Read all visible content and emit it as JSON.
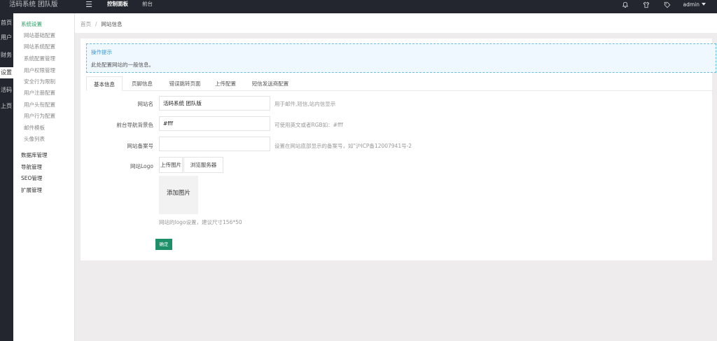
{
  "app": {
    "title": "活码系统 团队版"
  },
  "topnav": {
    "items": [
      "控制面板",
      "前台"
    ]
  },
  "topright": {
    "admin": "admin",
    "icons": [
      "bell-icon",
      "shirt-icon",
      "tag-icon"
    ]
  },
  "rail": {
    "items": [
      "首页",
      "用户",
      "财务",
      "设置",
      "活码",
      "上页"
    ]
  },
  "subnav": {
    "head": "系统设置",
    "children": [
      "网站基础配置",
      "网站系统配置",
      "系统配置管理",
      "用户权限管理",
      "安全行为限制",
      "用户注册配置",
      "用户头衔配置",
      "用户行为配置",
      "邮件模板",
      "头像列表"
    ],
    "groups": [
      "数据库管理",
      "导航管理",
      "SEO管理",
      "扩展管理"
    ]
  },
  "breadcrumb": {
    "home": "首页",
    "sep": "/",
    "current": "网站信息"
  },
  "tip": {
    "title": "操作提示",
    "desc": "此处配置网站的一般信息。"
  },
  "tabs": [
    "基本信息",
    "页脚信息",
    "错误跳转页面",
    "上传配置",
    "短信发送商配置"
  ],
  "form": {
    "site_name": {
      "label": "网站名",
      "value": "活码系统 团队版",
      "help": "用于邮件,短信,站内信显示"
    },
    "nav_bg": {
      "label": "前台导航背景色",
      "value": "#fff",
      "help": "可使用英文或者RGB如：#fff"
    },
    "icp": {
      "label": "网站备案号",
      "value": "",
      "help": "设置在网站底部显示的备案号，如\"沪ICP备12007941号-2"
    },
    "logo": {
      "label": "网站Logo",
      "upload": "上传图片",
      "browse": "浏览服务器",
      "add": "添加图片",
      "hint": "网站的logo设置，建议尺寸156*50"
    }
  },
  "submit": "确定",
  "colors": {
    "accent": "#2a9d63",
    "button": "#1e8f69",
    "topbar": "#23262e",
    "tip_border": "#6dbbe0"
  }
}
